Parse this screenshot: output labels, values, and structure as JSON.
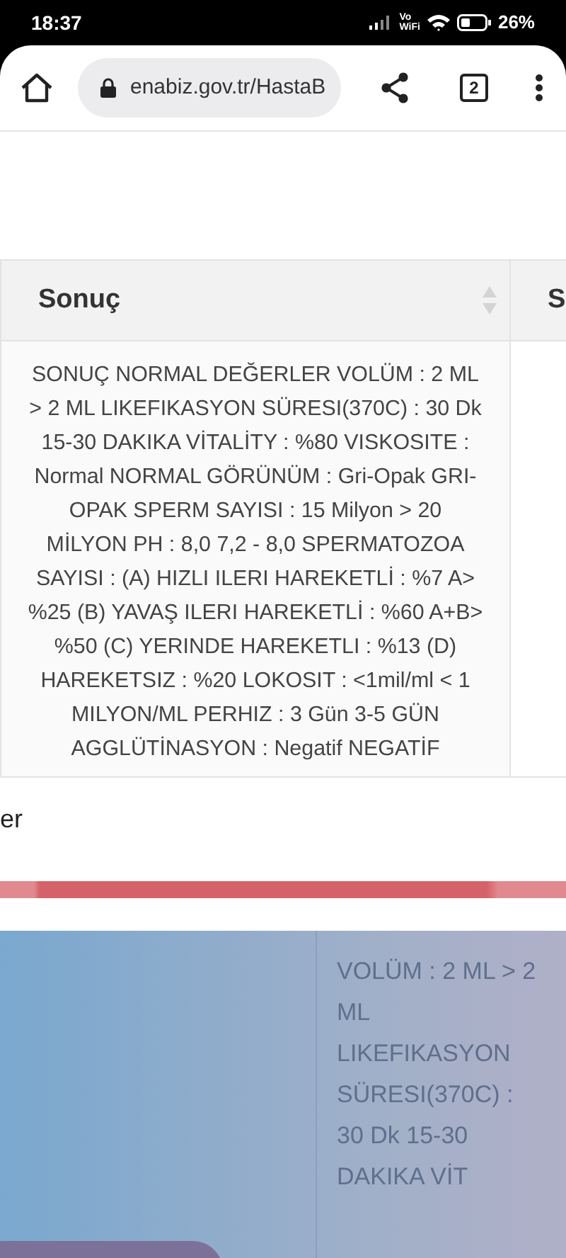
{
  "status_bar": {
    "time": "18:37",
    "network_label_top": "Vo",
    "network_label_bottom": "WiFi",
    "battery": "26%"
  },
  "browser": {
    "url": "enabiz.gov.tr/HastaB",
    "tab_count": "2"
  },
  "table": {
    "columns": [
      {
        "label": "Sonuç"
      },
      {
        "label": "S"
      }
    ],
    "rows": [
      {
        "cells": [
          "SONUÇ NORMAL DEĞERLER VOLÜM : 2 ML > 2 ML LIKEFIKASYON SÜRESI(370C) : 30 Dk 15-30 DAKIKA VİTALİTY : %80 VISKOSITE : Normal NORMAL GÖRÜNÜM : Gri-Opak GRI-OPAK SPERM SAYISI : 15 Milyon > 20 MİLYON PH : 8,0 7,2 - 8,0 SPERMATOZOA SAYISI : (A) HIZLI ILERI HAREKETLİ : %7 A> %25 (B) YAVAŞ ILERI HAREKETLİ : %60 A+B> %50 (C) YERINDE HAREKETLI : %13 (D) HAREKETSIZ : %20 LOKOSIT : <1mil/ml < 1 MILYON/ML PERHIZ : 3 Gün 3-5 GÜN AGGLÜTİNASYON : Negatif NEGATİF"
        ]
      }
    ]
  },
  "footer_fragment": "er",
  "background_panel": {
    "text": "VOLÜM : 2 ML > 2 ML LIKEFIKASYON SÜRESI(370C) : 30 Dk 15-30 DAKIKA VİT"
  }
}
